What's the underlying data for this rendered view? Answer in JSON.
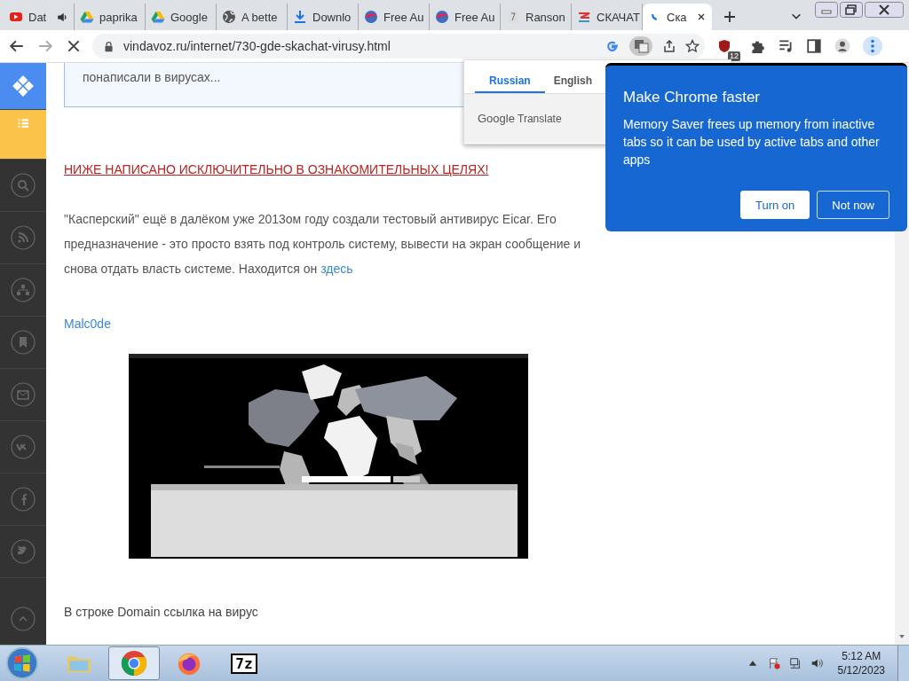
{
  "tabs": [
    {
      "title": "Dat",
      "kind": "video",
      "audio": true,
      "selected": false
    },
    {
      "title": "paprika",
      "kind": "drive",
      "audio": false,
      "selected": false
    },
    {
      "title": "Google",
      "kind": "drive",
      "audio": false,
      "selected": false
    },
    {
      "title": "A bette",
      "kind": "globe",
      "audio": false,
      "selected": false
    },
    {
      "title": "Downlo",
      "kind": "download",
      "audio": false,
      "selected": false
    },
    {
      "title": "Free Au",
      "kind": "ball",
      "audio": false,
      "selected": false
    },
    {
      "title": "Free Au",
      "kind": "ball",
      "audio": false,
      "selected": false
    },
    {
      "title": "Ranson",
      "kind": "page",
      "audio": false,
      "selected": false
    },
    {
      "title": "СКАЧАТ",
      "kind": "stripes",
      "audio": false,
      "selected": false
    },
    {
      "title": "Ска",
      "kind": "spinner",
      "audio": false,
      "selected": true
    }
  ],
  "toolbar": {
    "url": "vindavoz.ru/internet/730-gde-skachat-virusy.html",
    "loading": true,
    "extension_badge": "12"
  },
  "sidebar": {
    "items": [
      {
        "kind": "logo",
        "selected": false
      },
      {
        "kind": "list",
        "selected": true
      },
      {
        "kind": "search",
        "selected": false
      },
      {
        "kind": "rss",
        "selected": false
      },
      {
        "kind": "sitemap",
        "selected": false
      },
      {
        "kind": "bookmark",
        "selected": false
      },
      {
        "kind": "mail",
        "selected": false
      },
      {
        "kind": "vk",
        "selected": false
      },
      {
        "kind": "facebook",
        "selected": false
      },
      {
        "kind": "twitter",
        "selected": false
      },
      {
        "kind": "up",
        "selected": false
      }
    ]
  },
  "article": {
    "quote": "понаписали в вирусах...",
    "warning": "НИЖЕ НАПИСАНО ИСКЛЮЧИТЕЛЬНО В ОЗНАКОМИТЕЛЬНЫХ ЦЕЛЯХ!",
    "paragraph": "\"Касперский\" ещё в далёком уже 2013ом году создали тестовый антивирус Eicar. Его предназначение - это просто взять под контроль систему, вывести на экран сообщение и снова отдать власть системе. Находится он",
    "paragraph_link": "здесь",
    "heading_link": "Malc0de",
    "caption": "В строке Domain ссылка на вирус"
  },
  "translate_popup": {
    "tabs": [
      {
        "label": "Russian",
        "selected": true
      },
      {
        "label": "English",
        "selected": false
      }
    ],
    "footer_brand": "Google",
    "footer_label": "Translate"
  },
  "bubble": {
    "title": "Make Chrome faster",
    "body": "Memory Saver frees up memory from inactive tabs so it can be used by active tabs and other apps",
    "buttons": [
      {
        "label": "Turn on",
        "kind": "primary"
      },
      {
        "label": "Not now",
        "kind": "secondary"
      }
    ]
  },
  "taskbar": {
    "apps": [
      {
        "kind": "folder",
        "selected": false
      },
      {
        "kind": "chrome",
        "selected": true
      },
      {
        "kind": "firefox",
        "selected": false
      },
      {
        "kind": "archiver",
        "label": "7z",
        "selected": false
      }
    ],
    "time": "5:12 AM",
    "date": "5/12/2023"
  }
}
